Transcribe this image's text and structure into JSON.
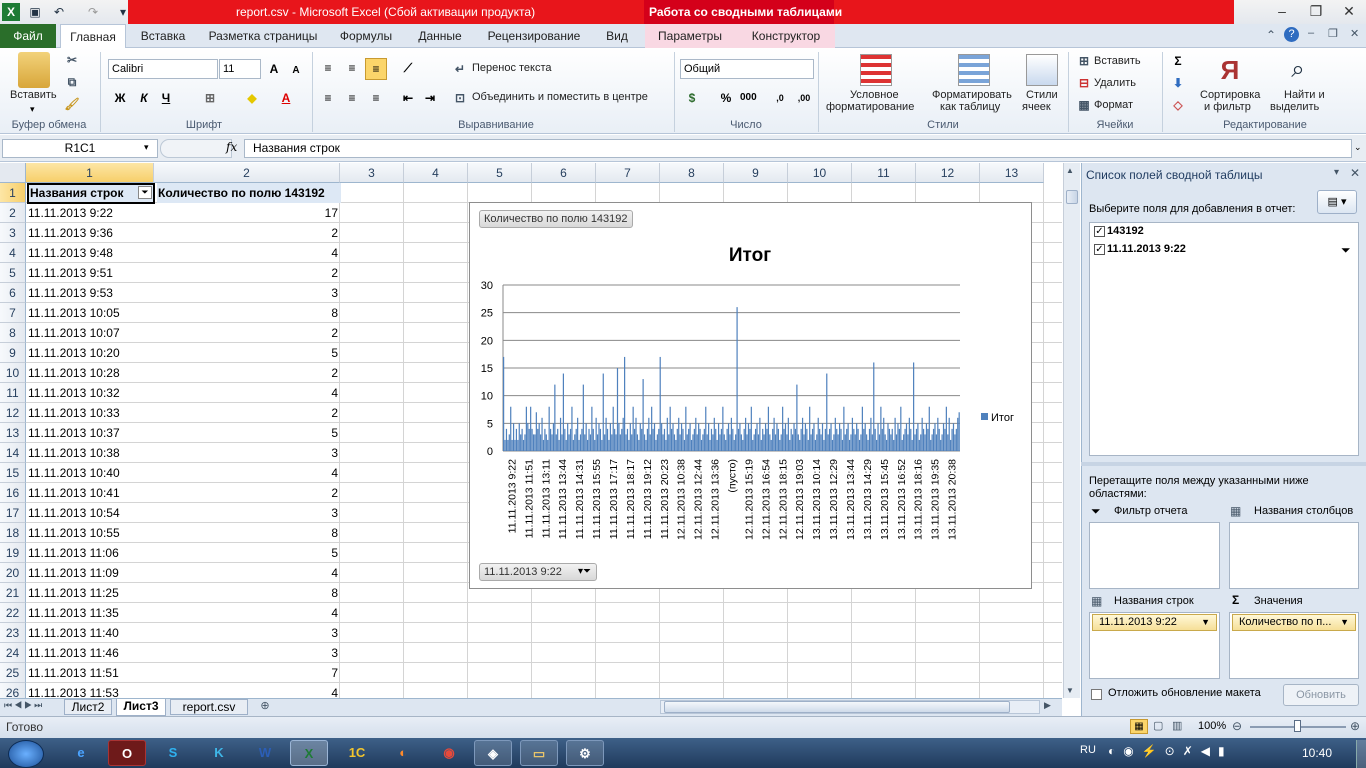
{
  "title_bar": {
    "filename": "report.csv",
    "app": "Microsoft Excel (Сбой активации продукта)",
    "context": "Работа со сводными таблицами"
  },
  "tabs": [
    "Файл",
    "Главная",
    "Вставка",
    "Разметка страницы",
    "Формулы",
    "Данные",
    "Рецензирование",
    "Вид",
    "Параметры",
    "Конструктор"
  ],
  "ribbon": {
    "clipboard": {
      "paste": "Вставить",
      "label": "Буфер обмена"
    },
    "font": {
      "name": "Calibri",
      "size": "11",
      "label": "Шрифт",
      "bold": "Ж",
      "italic": "К",
      "underline": "Ч"
    },
    "alignment": {
      "wrap": "Перенос текста",
      "merge": "Объединить и поместить в центре",
      "label": "Выравнивание"
    },
    "number": {
      "format": "Общий",
      "label": "Число"
    },
    "styles": {
      "conditional": "Условное",
      "conditional2": "форматирование",
      "format_table": "Форматировать",
      "format_table2": "как таблицу",
      "cell_styles": "Стили",
      "cell_styles2": "ячеек",
      "label": "Стили"
    },
    "cells": {
      "insert": "Вставить",
      "delete": "Удалить",
      "format": "Формат",
      "label": "Ячейки"
    },
    "editing": {
      "sort": "Сортировка",
      "sort2": "и фильтр",
      "find": "Найти и",
      "find2": "выделить",
      "label": "Редактирование"
    }
  },
  "formula_bar": {
    "name_box": "R1C1",
    "fx": "fx",
    "content": "Названия строк"
  },
  "columns": [
    "1",
    "2",
    "3",
    "4",
    "5",
    "6",
    "7",
    "8",
    "9",
    "10",
    "11",
    "12",
    "13"
  ],
  "header_row": {
    "a": "Названия строк",
    "b": "Количество по полю 143192"
  },
  "rows": [
    {
      "n": "1",
      "a": "",
      "b": ""
    },
    {
      "n": "2",
      "a": "11.11.2013 9:22",
      "b": "17"
    },
    {
      "n": "3",
      "a": "11.11.2013 9:36",
      "b": "2"
    },
    {
      "n": "4",
      "a": "11.11.2013 9:48",
      "b": "4"
    },
    {
      "n": "5",
      "a": "11.11.2013 9:51",
      "b": "2"
    },
    {
      "n": "6",
      "a": "11.11.2013 9:53",
      "b": "3"
    },
    {
      "n": "7",
      "a": "11.11.2013 10:05",
      "b": "8"
    },
    {
      "n": "8",
      "a": "11.11.2013 10:07",
      "b": "2"
    },
    {
      "n": "9",
      "a": "11.11.2013 10:20",
      "b": "5"
    },
    {
      "n": "10",
      "a": "11.11.2013 10:28",
      "b": "2"
    },
    {
      "n": "11",
      "a": "11.11.2013 10:32",
      "b": "4"
    },
    {
      "n": "12",
      "a": "11.11.2013 10:33",
      "b": "2"
    },
    {
      "n": "13",
      "a": "11.11.2013 10:37",
      "b": "5"
    },
    {
      "n": "14",
      "a": "11.11.2013 10:38",
      "b": "3"
    },
    {
      "n": "15",
      "a": "11.11.2013 10:40",
      "b": "4"
    },
    {
      "n": "16",
      "a": "11.11.2013 10:41",
      "b": "2"
    },
    {
      "n": "17",
      "a": "11.11.2013 10:54",
      "b": "3"
    },
    {
      "n": "18",
      "a": "11.11.2013 10:55",
      "b": "8"
    },
    {
      "n": "19",
      "a": "11.11.2013 11:06",
      "b": "5"
    },
    {
      "n": "20",
      "a": "11.11.2013 11:09",
      "b": "4"
    },
    {
      "n": "21",
      "a": "11.11.2013 11:25",
      "b": "8"
    },
    {
      "n": "22",
      "a": "11.11.2013 11:35",
      "b": "4"
    },
    {
      "n": "23",
      "a": "11.11.2013 11:40",
      "b": "3"
    },
    {
      "n": "24",
      "a": "11.11.2013 11:46",
      "b": "3"
    },
    {
      "n": "25",
      "a": "11.11.2013 11:51",
      "b": "7"
    },
    {
      "n": "26",
      "a": "11.11.2013 11:53",
      "b": "4"
    }
  ],
  "chart": {
    "value_button": "Количество по полю 143192",
    "axis_button": "11.11.2013 9:22",
    "legend": "Итог"
  },
  "chart_data": {
    "type": "bar",
    "title": "Итог",
    "ylim": [
      0,
      30
    ],
    "yticks": [
      "0",
      "5",
      "10",
      "15",
      "20",
      "25",
      "30"
    ],
    "tick_labels": [
      "11.11.2013 9:22",
      "11.11.2013 11:51",
      "11.11.2013 13:11",
      "11.11.2013 13:44",
      "11.11.2013 14:31",
      "11.11.2013 15:55",
      "11.11.2013 17:17",
      "11.11.2013 18:17",
      "11.11.2013 19:12",
      "11.11.2013 20:23",
      "12.11.2013 10:38",
      "12.11.2013 12:44",
      "12.11.2013 13:36",
      "(пусто)",
      "12.11.2013 15:19",
      "12.11.2013 16:54",
      "12.11.2013 18:15",
      "12.11.2013 19:03",
      "13.11.2013 10:14",
      "13.11.2013 12:29",
      "13.11.2013 13:44",
      "13.11.2013 14:29",
      "13.11.2013 15:45",
      "13.11.2013 16:52",
      "13.11.2013 18:16",
      "13.11.2013 19:35",
      "13.11.2013 20:38"
    ],
    "series": [
      {
        "name": "Итог",
        "values": [
          17,
          2,
          4,
          2,
          3,
          8,
          2,
          5,
          2,
          4,
          2,
          5,
          3,
          4,
          2,
          3,
          8,
          5,
          4,
          8,
          4,
          3,
          3,
          7,
          4,
          5,
          3,
          6,
          2,
          4,
          3,
          2,
          8,
          4,
          3,
          5,
          12,
          3,
          4,
          2,
          6,
          3,
          14,
          4,
          2,
          5,
          3,
          4,
          8,
          2,
          3,
          4,
          6,
          2,
          3,
          4,
          12,
          3,
          5,
          2,
          4,
          3,
          8,
          4,
          2,
          6,
          3,
          5,
          4,
          2,
          14,
          3,
          6,
          4,
          2,
          5,
          3,
          8,
          4,
          3,
          15,
          5,
          3,
          4,
          6,
          17,
          3,
          4,
          2,
          5,
          3,
          8,
          4,
          6,
          3,
          2,
          5,
          4,
          13,
          3,
          2,
          4,
          6,
          3,
          8,
          4,
          5,
          2,
          3,
          4,
          17,
          5,
          3,
          4,
          2,
          6,
          3,
          8,
          4,
          5,
          3,
          2,
          4,
          6,
          3,
          5,
          4,
          2,
          8,
          3,
          4,
          5,
          2,
          3,
          4,
          6,
          3,
          5,
          4,
          2,
          3,
          4,
          8,
          3,
          5,
          2,
          4,
          3,
          6,
          4,
          2,
          5,
          3,
          4,
          8,
          3,
          2,
          4,
          5,
          3,
          6,
          4,
          2,
          3,
          26,
          4,
          5,
          3,
          2,
          4,
          6,
          3,
          5,
          4,
          8,
          2,
          3,
          4,
          5,
          3,
          6,
          2,
          4,
          3,
          5,
          4,
          8,
          3,
          2,
          4,
          6,
          3,
          5,
          4,
          2,
          3,
          8,
          4,
          5,
          3,
          6,
          2,
          4,
          3,
          5,
          4,
          12,
          3,
          2,
          4,
          6,
          3,
          5,
          4,
          2,
          8,
          3,
          4,
          5,
          2,
          3,
          6,
          4,
          3,
          5,
          2,
          4,
          14,
          3,
          4,
          5,
          2,
          3,
          6,
          4,
          3,
          5,
          4,
          2,
          8,
          3,
          4,
          5,
          2,
          3,
          6,
          4,
          3,
          5,
          4,
          2,
          3,
          8,
          4,
          5,
          3,
          2,
          4,
          6,
          3,
          16,
          4,
          2,
          5,
          3,
          8,
          4,
          6,
          3,
          2,
          5,
          4,
          3,
          4,
          2,
          6,
          3,
          5,
          4,
          8,
          2,
          3,
          4,
          5,
          3,
          6,
          4,
          2,
          16,
          3,
          4,
          5,
          2,
          3,
          6,
          4,
          3,
          5,
          4,
          8,
          2,
          3,
          4,
          5,
          3,
          6,
          4,
          2,
          3,
          5,
          4,
          8,
          3,
          6,
          2,
          4,
          5,
          3,
          4,
          6,
          7
        ]
      }
    ]
  },
  "pivot_pane": {
    "title": "Список полей сводной таблицы",
    "choose_fields": "Выберите поля для добавления в отчет:",
    "fields": [
      "143192",
      "11.11.2013 9:22"
    ],
    "drag_hint": "Перетащите поля между указанными ниже областями:",
    "report_filter": "Фильтр отчета",
    "column_labels": "Названия столбцов",
    "row_labels": "Названия строк",
    "values": "Значения",
    "row_item": "11.11.2013 9:22",
    "value_item": "Количество по п...",
    "defer": "Отложить обновление макета",
    "update": "Обновить"
  },
  "sheet_tabs": [
    "Лист2",
    "Лист3",
    "report.csv"
  ],
  "status": {
    "ready": "Готово",
    "zoom": "100%"
  },
  "taskbar": {
    "lang": "RU",
    "time": "10:40"
  }
}
